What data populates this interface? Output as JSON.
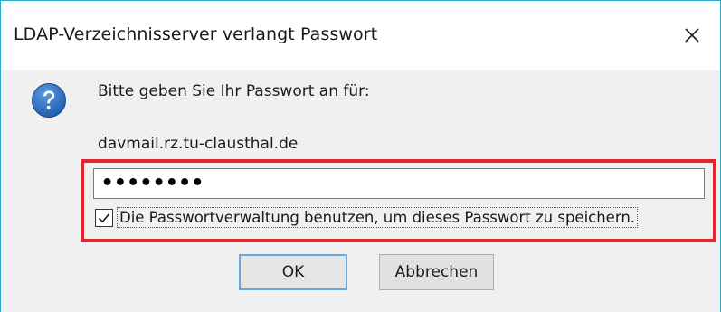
{
  "dialog": {
    "title": "LDAP-Verzeichnisserver verlangt Passwort",
    "prompt": "Bitte geben Sie Ihr Passwort an für:",
    "host": "davmail.rz.tu-clausthal.de",
    "password_masked": "••••••••",
    "remember_checked": true,
    "remember_label": "Die Passwortverwaltung benutzen, um dieses Passwort zu speichern.",
    "ok_label": "OK",
    "cancel_label": "Abbrechen",
    "icon": "question-icon",
    "close_icon": "close-icon"
  },
  "colors": {
    "highlight_border": "#e3262d",
    "window_border": "#2aa9c9",
    "icon_blue": "#1f5fae",
    "default_button_border": "#6aa7dd"
  }
}
